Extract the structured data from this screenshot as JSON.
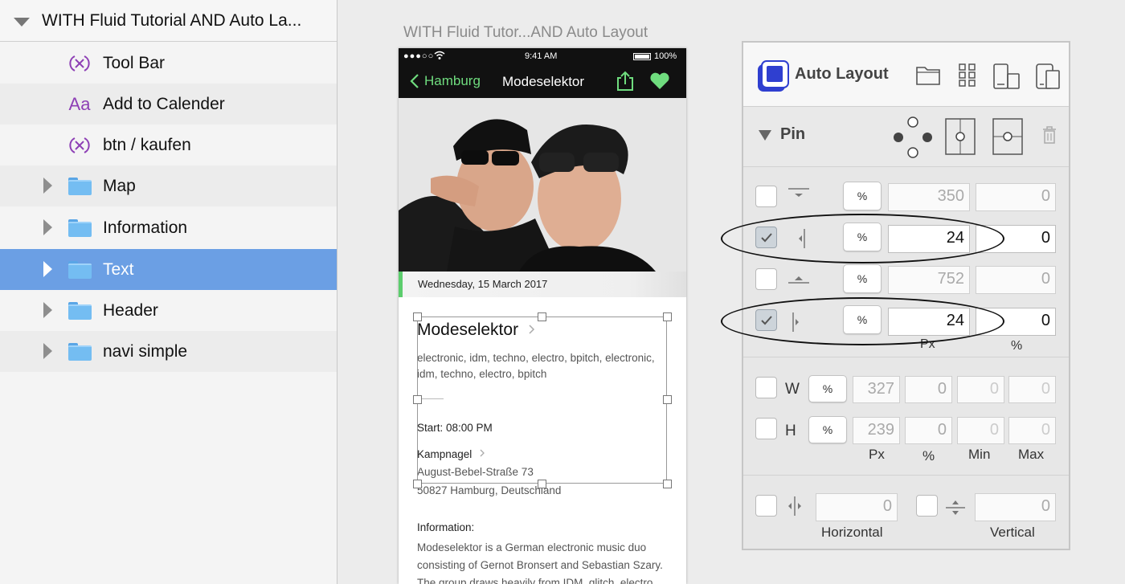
{
  "layers": {
    "header_label": "WITH Fluid Tutorial AND Auto La...",
    "items": [
      {
        "label": "Tool Bar",
        "icon": "symbol-icon"
      },
      {
        "label": "Add to Calender",
        "icon": "text-icon",
        "icon_text": "Aa"
      },
      {
        "label": "btn / kaufen",
        "icon": "symbol-icon"
      },
      {
        "label": "Map",
        "icon": "folder-icon"
      },
      {
        "label": "Information",
        "icon": "folder-icon"
      },
      {
        "label": "Text",
        "icon": "folder-icon",
        "selected": true
      },
      {
        "label": "Header",
        "icon": "folder-icon"
      },
      {
        "label": "navi simple",
        "icon": "folder-icon"
      }
    ]
  },
  "artboard": {
    "title": "WITH Fluid Tutor...AND Auto Layout",
    "status_bar": {
      "signal": "●●●○○",
      "time": "9:41 AM",
      "battery": "100%"
    },
    "nav": {
      "back_label": "Hamburg",
      "title": "Modeselektor"
    },
    "date": "Wednesday, 15 March 2017",
    "event": {
      "title": "Modeselektor",
      "tags": "electronic, idm, techno, electro, bpitch, electronic, idm, techno, electro, bpitch",
      "start": "Start: 08:00 PM",
      "venue": "Kampnagel",
      "street": "August-Bebel-Straße 73",
      "city": "50827 Hamburg, Deutschland",
      "info_label": "Information:",
      "info_text": "Modeselektor is a German electronic music duo consisting of Gernot Bronsert and Sebastian Szary. The group draws heavily from IDM, glitch, electro"
    }
  },
  "panel": {
    "title": "Auto Layout",
    "pin": {
      "title": "Pin",
      "rows": [
        {
          "name": "top",
          "checked": false,
          "pct": "%",
          "px": "350",
          "percent": "0",
          "active": false
        },
        {
          "name": "left",
          "checked": true,
          "pct": "%",
          "px": "24",
          "percent": "0",
          "active": true
        },
        {
          "name": "bottom",
          "checked": false,
          "pct": "%",
          "px": "752",
          "percent": "0",
          "active": false
        },
        {
          "name": "right",
          "checked": true,
          "pct": "%",
          "px": "24",
          "percent": "0",
          "active": true
        }
      ],
      "col_px": "Px",
      "col_pct": "%"
    },
    "size": {
      "w_label": "W",
      "h_label": "H",
      "pct": "%",
      "w": {
        "px": "327",
        "percent": "0",
        "min": "0",
        "max": "0"
      },
      "h": {
        "px": "239",
        "percent": "0",
        "min": "0",
        "max": "0"
      },
      "cols": [
        "Px",
        "%",
        "Min",
        "Max"
      ]
    },
    "center": {
      "horizontal_value": "0",
      "vertical_value": "0",
      "horizontal_label": "Horizontal",
      "vertical_label": "Vertical"
    }
  },
  "colors": {
    "selection": "#6b9fe4",
    "accent_green": "#6fdc7e",
    "logo_blue": "#2f3fd0"
  }
}
